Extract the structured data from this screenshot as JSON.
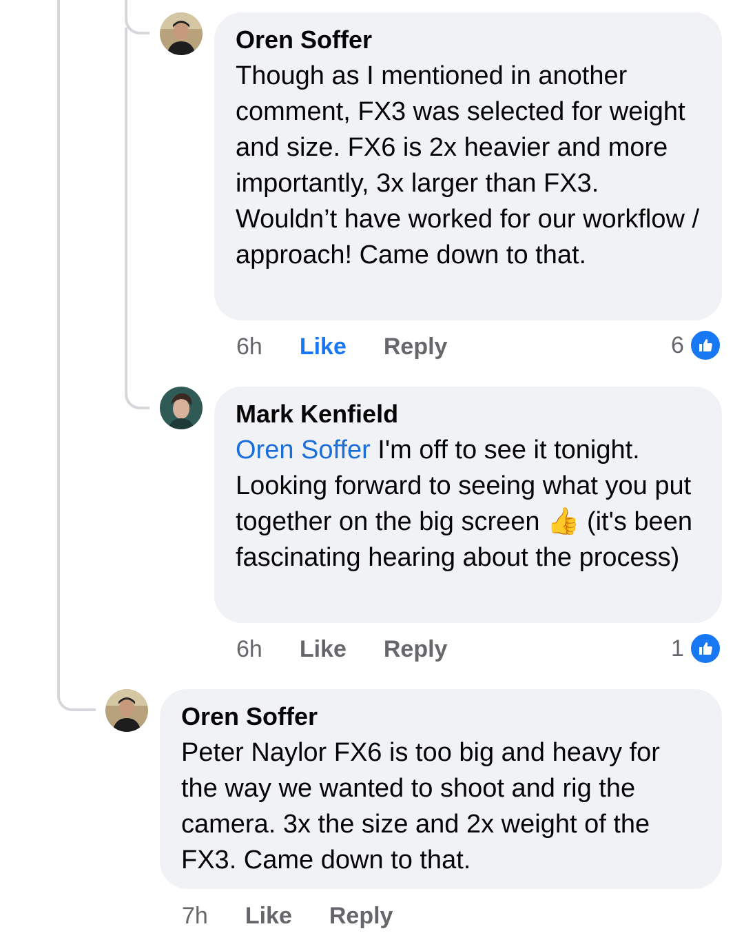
{
  "comments": [
    {
      "author": "Oren Soffer",
      "text": "Though as I mentioned in another comment, FX3 was selected for weight and size. FX6 is 2x heavier and more importantly, 3x larger than FX3. Wouldn’t have worked for our workflow / approach! Came down to that.",
      "time": "6h",
      "like_label": "Like",
      "reply_label": "Reply",
      "reaction_count": "6",
      "liked": true
    },
    {
      "author": "Mark Kenfield",
      "mention": "Oren Soffer",
      "text": " I'm off to see it tonight. Looking forward to seeing what you put together on the big screen 👍 (it's been fascinating hearing about the process)",
      "time": "6h",
      "like_label": "Like",
      "reply_label": "Reply",
      "reaction_count": "1",
      "liked": false
    },
    {
      "author": "Oren Soffer",
      "text": "Peter Naylor FX6 is too big and heavy for the way we wanted to shoot and rig the camera. 3x the size and 2x weight of the FX3. Came down to that.",
      "time": "7h",
      "like_label": "Like",
      "reply_label": "Reply"
    }
  ],
  "colors": {
    "bubble": "#f0f2f5",
    "like_active": "#1877f2",
    "mention": "#1a6ed8",
    "meta": "#65676b"
  },
  "icons": {
    "reaction": "thumbs-up-icon",
    "emoji": "thumbs-up-emoji"
  }
}
